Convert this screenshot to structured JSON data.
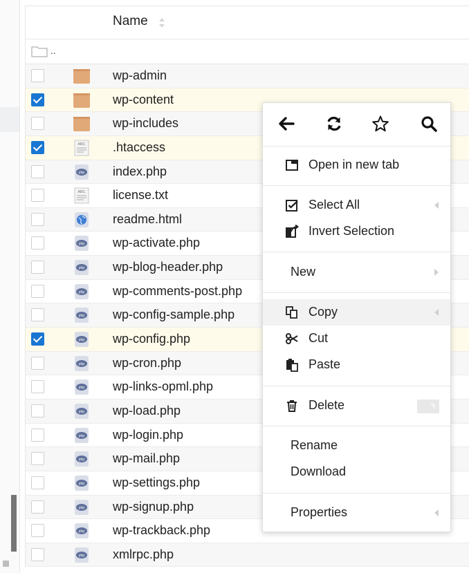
{
  "table": {
    "header": {
      "name_label": "Name"
    },
    "parent_label": "..",
    "rows": [
      {
        "name": "wp-admin",
        "type": "folder",
        "checked": false
      },
      {
        "name": "wp-content",
        "type": "folder",
        "checked": true
      },
      {
        "name": "wp-includes",
        "type": "folder",
        "checked": false
      },
      {
        "name": ".htaccess",
        "type": "text",
        "checked": true
      },
      {
        "name": "index.php",
        "type": "php",
        "checked": false
      },
      {
        "name": "license.txt",
        "type": "text",
        "checked": false
      },
      {
        "name": "readme.html",
        "type": "html",
        "checked": false
      },
      {
        "name": "wp-activate.php",
        "type": "php",
        "checked": false
      },
      {
        "name": "wp-blog-header.php",
        "type": "php",
        "checked": false
      },
      {
        "name": "wp-comments-post.php",
        "type": "php",
        "checked": false
      },
      {
        "name": "wp-config-sample.php",
        "type": "php",
        "checked": false
      },
      {
        "name": "wp-config.php",
        "type": "php",
        "checked": true
      },
      {
        "name": "wp-cron.php",
        "type": "php",
        "checked": false
      },
      {
        "name": "wp-links-opml.php",
        "type": "php",
        "checked": false
      },
      {
        "name": "wp-load.php",
        "type": "php",
        "checked": false
      },
      {
        "name": "wp-login.php",
        "type": "php",
        "checked": false
      },
      {
        "name": "wp-mail.php",
        "type": "php",
        "checked": false
      },
      {
        "name": "wp-settings.php",
        "type": "php",
        "checked": false
      },
      {
        "name": "wp-signup.php",
        "type": "php",
        "checked": false
      },
      {
        "name": "wp-trackback.php",
        "type": "php",
        "checked": false
      },
      {
        "name": "xmlrpc.php",
        "type": "php",
        "checked": false
      }
    ]
  },
  "context_menu": {
    "toolbar": [
      {
        "name": "back-icon"
      },
      {
        "name": "refresh-icon"
      },
      {
        "name": "star-icon"
      },
      {
        "name": "search-icon"
      }
    ],
    "open_new_tab": "Open in new tab",
    "select_all": "Select All",
    "invert_selection": "Invert Selection",
    "new": "New",
    "copy": "Copy",
    "cut": "Cut",
    "paste": "Paste",
    "delete": "Delete",
    "rename": "Rename",
    "download": "Download",
    "properties": "Properties"
  },
  "colors": {
    "accent": "#1976d2",
    "checked_row": "#fffbea",
    "alt_row": "#f7f7f7",
    "folder": "#e2a978"
  }
}
